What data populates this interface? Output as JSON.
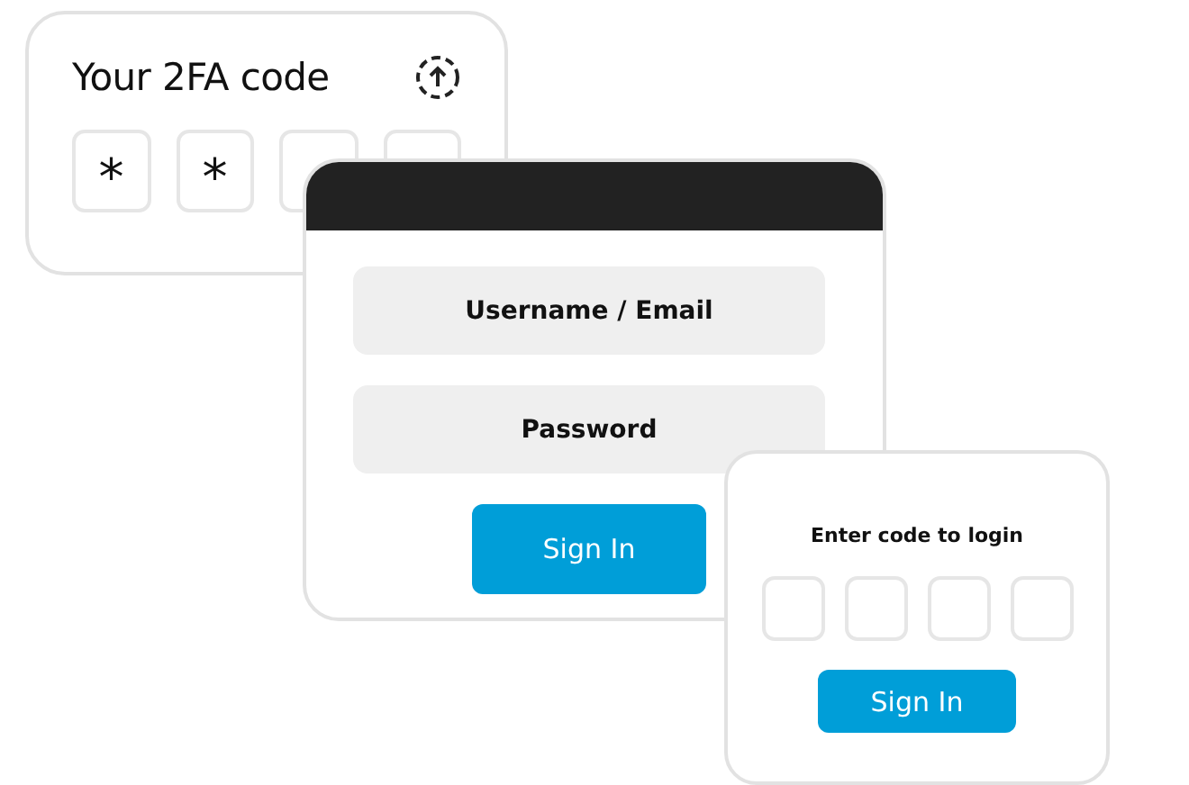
{
  "code_card": {
    "title": "Your 2FA code",
    "slots": [
      {
        "kind": "filled",
        "char": "*"
      },
      {
        "kind": "filled",
        "char": "*"
      },
      {
        "kind": "empty"
      },
      {
        "kind": "empty"
      }
    ]
  },
  "login_window": {
    "fields": [
      {
        "placeholder": "Username / Email"
      },
      {
        "placeholder": "Password"
      }
    ],
    "button": "Sign In"
  },
  "verify_card": {
    "prompt": "Enter code to login",
    "slots": [
      {
        "kind": "empty"
      },
      {
        "kind": "empty"
      },
      {
        "kind": "empty"
      },
      {
        "kind": "empty"
      }
    ],
    "button": "Sign In"
  }
}
